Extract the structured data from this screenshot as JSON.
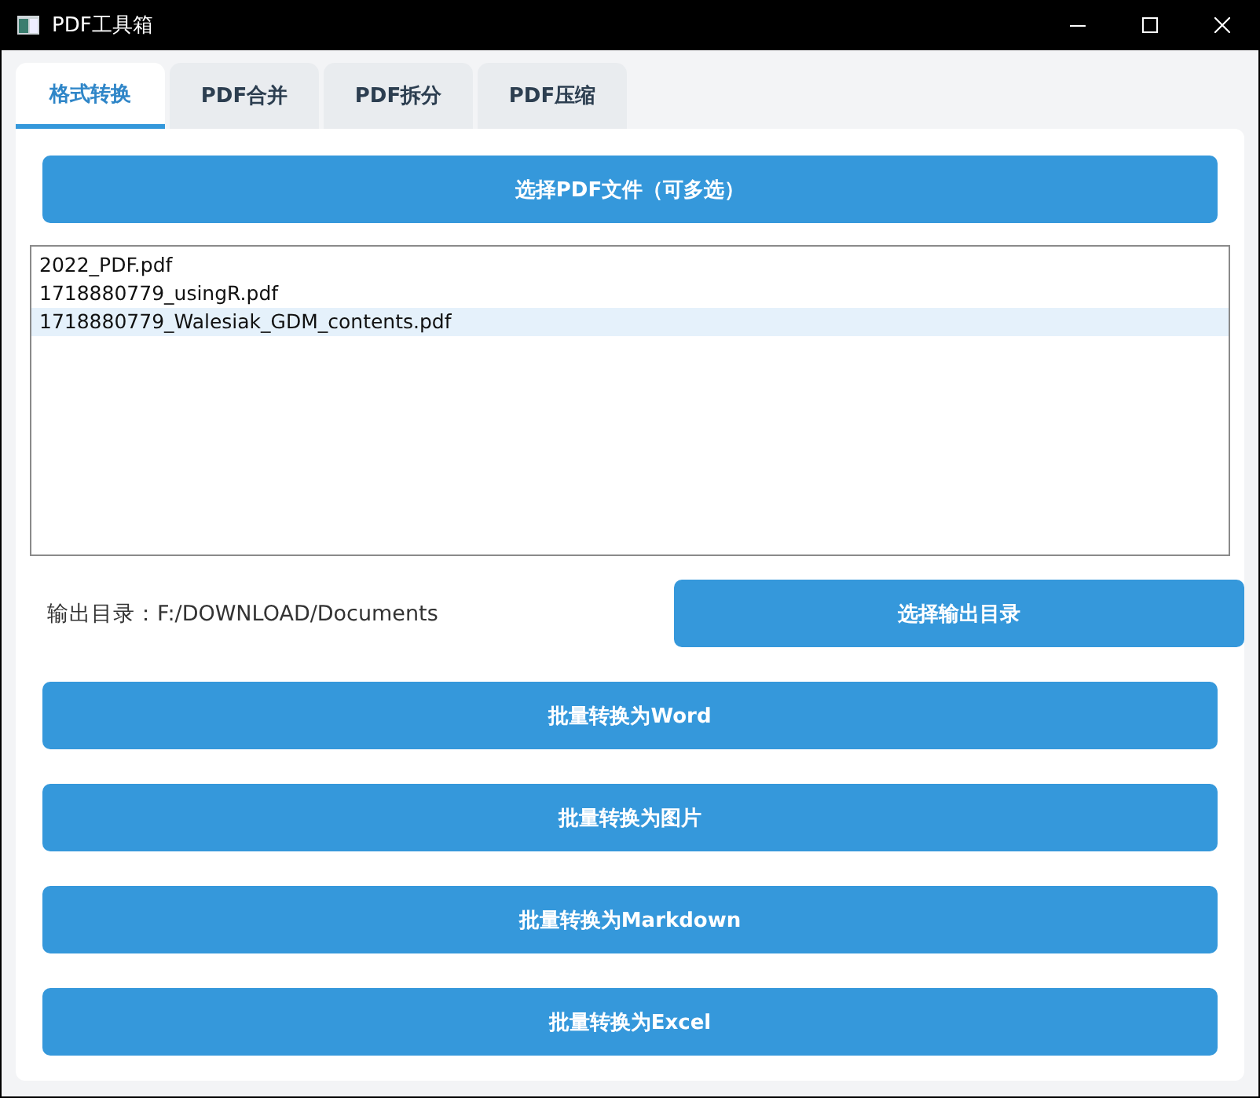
{
  "window": {
    "title": "PDF工具箱"
  },
  "tabs": [
    {
      "label": "格式转换",
      "selected": true
    },
    {
      "label": "PDF合并",
      "selected": false
    },
    {
      "label": "PDF拆分",
      "selected": false
    },
    {
      "label": "PDF压缩",
      "selected": false
    }
  ],
  "select_button": "选择PDF文件（可多选）",
  "files": [
    {
      "name": "2022_PDF.pdf",
      "selected": false
    },
    {
      "name": "1718880779_usingR.pdf",
      "selected": false
    },
    {
      "name": "1718880779_Walesiak_GDM_contents.pdf",
      "selected": true
    }
  ],
  "output": {
    "label": "输出目录：F:/DOWNLOAD/Documents",
    "button": "选择输出目录"
  },
  "actions": [
    "批量转换为Word",
    "批量转换为图片",
    "批量转换为Markdown",
    "批量转换为Excel"
  ]
}
